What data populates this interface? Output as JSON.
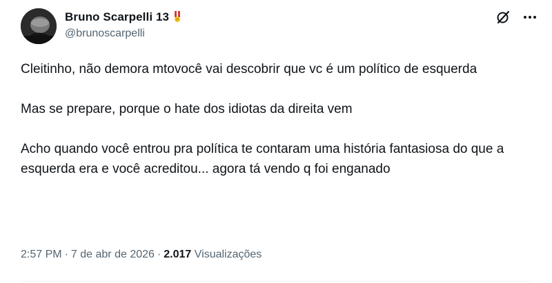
{
  "author": {
    "display_name": "Bruno Scarpelli 13",
    "handle": "@brunoscarpelli"
  },
  "actions": {
    "grok_icon": "grok-icon",
    "more_icon": "more-icon"
  },
  "tweet": {
    "paragraphs": [
      "Cleitinho, não demora mtovocê vai descobrir que vc é um político de esquerda",
      "Mas se prepare, porque o hate dos idiotas da direita vem",
      "Acho quando você entrou pra política te contaram uma história fantasiosa do que a esquerda era e você acreditou... agora tá vendo q foi enganado"
    ]
  },
  "meta": {
    "time": "2:57 PM",
    "separator": "·",
    "date": "7 de abr de 2026",
    "views_count": "2.017",
    "views_label": "Visualizações"
  },
  "colors": {
    "text": "#0f1419",
    "secondary": "#536471",
    "divider": "#eff3f4"
  }
}
